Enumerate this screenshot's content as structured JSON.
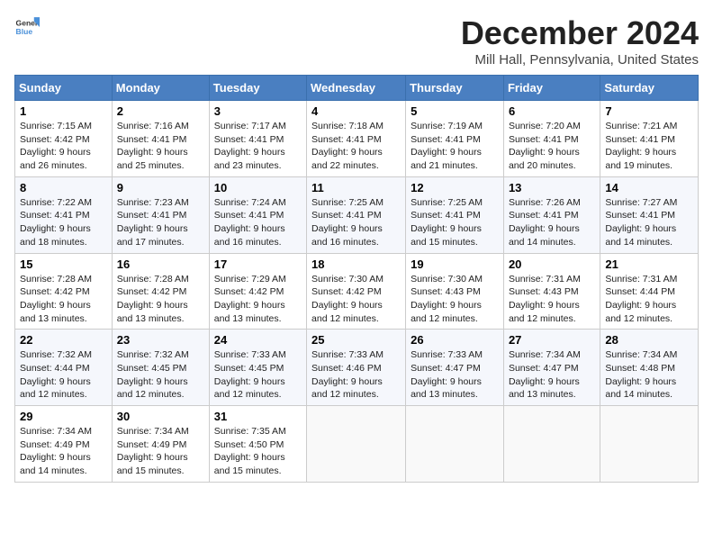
{
  "logo": {
    "general": "General",
    "blue": "Blue"
  },
  "title": "December 2024",
  "subtitle": "Mill Hall, Pennsylvania, United States",
  "days_of_week": [
    "Sunday",
    "Monday",
    "Tuesday",
    "Wednesday",
    "Thursday",
    "Friday",
    "Saturday"
  ],
  "weeks": [
    [
      {
        "day": 1,
        "sunrise": "7:15 AM",
        "sunset": "4:42 PM",
        "daylight": "9 hours and 26 minutes."
      },
      {
        "day": 2,
        "sunrise": "7:16 AM",
        "sunset": "4:41 PM",
        "daylight": "9 hours and 25 minutes."
      },
      {
        "day": 3,
        "sunrise": "7:17 AM",
        "sunset": "4:41 PM",
        "daylight": "9 hours and 23 minutes."
      },
      {
        "day": 4,
        "sunrise": "7:18 AM",
        "sunset": "4:41 PM",
        "daylight": "9 hours and 22 minutes."
      },
      {
        "day": 5,
        "sunrise": "7:19 AM",
        "sunset": "4:41 PM",
        "daylight": "9 hours and 21 minutes."
      },
      {
        "day": 6,
        "sunrise": "7:20 AM",
        "sunset": "4:41 PM",
        "daylight": "9 hours and 20 minutes."
      },
      {
        "day": 7,
        "sunrise": "7:21 AM",
        "sunset": "4:41 PM",
        "daylight": "9 hours and 19 minutes."
      }
    ],
    [
      {
        "day": 8,
        "sunrise": "7:22 AM",
        "sunset": "4:41 PM",
        "daylight": "9 hours and 18 minutes."
      },
      {
        "day": 9,
        "sunrise": "7:23 AM",
        "sunset": "4:41 PM",
        "daylight": "9 hours and 17 minutes."
      },
      {
        "day": 10,
        "sunrise": "7:24 AM",
        "sunset": "4:41 PM",
        "daylight": "9 hours and 16 minutes."
      },
      {
        "day": 11,
        "sunrise": "7:25 AM",
        "sunset": "4:41 PM",
        "daylight": "9 hours and 16 minutes."
      },
      {
        "day": 12,
        "sunrise": "7:25 AM",
        "sunset": "4:41 PM",
        "daylight": "9 hours and 15 minutes."
      },
      {
        "day": 13,
        "sunrise": "7:26 AM",
        "sunset": "4:41 PM",
        "daylight": "9 hours and 14 minutes."
      },
      {
        "day": 14,
        "sunrise": "7:27 AM",
        "sunset": "4:41 PM",
        "daylight": "9 hours and 14 minutes."
      }
    ],
    [
      {
        "day": 15,
        "sunrise": "7:28 AM",
        "sunset": "4:42 PM",
        "daylight": "9 hours and 13 minutes."
      },
      {
        "day": 16,
        "sunrise": "7:28 AM",
        "sunset": "4:42 PM",
        "daylight": "9 hours and 13 minutes."
      },
      {
        "day": 17,
        "sunrise": "7:29 AM",
        "sunset": "4:42 PM",
        "daylight": "9 hours and 13 minutes."
      },
      {
        "day": 18,
        "sunrise": "7:30 AM",
        "sunset": "4:42 PM",
        "daylight": "9 hours and 12 minutes."
      },
      {
        "day": 19,
        "sunrise": "7:30 AM",
        "sunset": "4:43 PM",
        "daylight": "9 hours and 12 minutes."
      },
      {
        "day": 20,
        "sunrise": "7:31 AM",
        "sunset": "4:43 PM",
        "daylight": "9 hours and 12 minutes."
      },
      {
        "day": 21,
        "sunrise": "7:31 AM",
        "sunset": "4:44 PM",
        "daylight": "9 hours and 12 minutes."
      }
    ],
    [
      {
        "day": 22,
        "sunrise": "7:32 AM",
        "sunset": "4:44 PM",
        "daylight": "9 hours and 12 minutes."
      },
      {
        "day": 23,
        "sunrise": "7:32 AM",
        "sunset": "4:45 PM",
        "daylight": "9 hours and 12 minutes."
      },
      {
        "day": 24,
        "sunrise": "7:33 AM",
        "sunset": "4:45 PM",
        "daylight": "9 hours and 12 minutes."
      },
      {
        "day": 25,
        "sunrise": "7:33 AM",
        "sunset": "4:46 PM",
        "daylight": "9 hours and 12 minutes."
      },
      {
        "day": 26,
        "sunrise": "7:33 AM",
        "sunset": "4:47 PM",
        "daylight": "9 hours and 13 minutes."
      },
      {
        "day": 27,
        "sunrise": "7:34 AM",
        "sunset": "4:47 PM",
        "daylight": "9 hours and 13 minutes."
      },
      {
        "day": 28,
        "sunrise": "7:34 AM",
        "sunset": "4:48 PM",
        "daylight": "9 hours and 14 minutes."
      }
    ],
    [
      {
        "day": 29,
        "sunrise": "7:34 AM",
        "sunset": "4:49 PM",
        "daylight": "9 hours and 14 minutes."
      },
      {
        "day": 30,
        "sunrise": "7:34 AM",
        "sunset": "4:49 PM",
        "daylight": "9 hours and 15 minutes."
      },
      {
        "day": 31,
        "sunrise": "7:35 AM",
        "sunset": "4:50 PM",
        "daylight": "9 hours and 15 minutes."
      },
      null,
      null,
      null,
      null
    ]
  ],
  "labels": {
    "sunrise": "Sunrise:",
    "sunset": "Sunset:",
    "daylight": "Daylight:"
  }
}
